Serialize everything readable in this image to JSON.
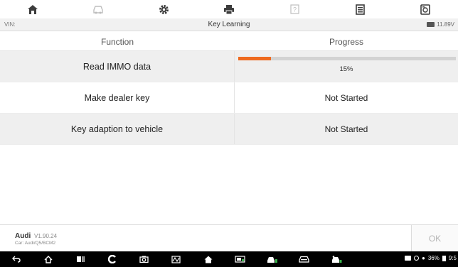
{
  "toolbar": {
    "items": [
      {
        "icon": "home-icon"
      },
      {
        "icon": "vehicle-swap-icon"
      },
      {
        "icon": "settings-icon"
      },
      {
        "icon": "print-icon"
      },
      {
        "icon": "help-icon"
      },
      {
        "icon": "data-manager-icon"
      },
      {
        "icon": "screenshot-icon"
      }
    ]
  },
  "status": {
    "vin_label": "VIN:",
    "title": "Key Learning",
    "voltage": "11.89V"
  },
  "table": {
    "headers": [
      "Function",
      "Progress"
    ],
    "rows": [
      {
        "function": "Read IMMO data",
        "progress_text": "15%",
        "progress_value": 15
      },
      {
        "function": "Make dealer key",
        "progress_text": "Not Started"
      },
      {
        "function": "Key adaption to vehicle",
        "progress_text": "Not Started"
      }
    ]
  },
  "footer": {
    "make": "Audi",
    "version": "V1.90.24",
    "path": "Car: Audi/Q5/BCM2",
    "ok_label": "OK"
  },
  "system": {
    "status_text": "36%",
    "clock": "9:5"
  },
  "colors": {
    "progress_fill": "#ee6a1f",
    "progress_track": "#d3d3d3",
    "icon": "#3c3c3c"
  }
}
